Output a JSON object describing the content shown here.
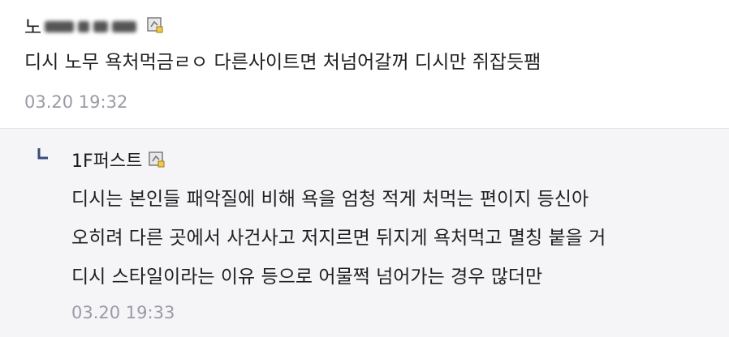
{
  "comment": {
    "nickname_visible": "노",
    "text": "디시 노무 욕처먹금ㄹㅇ 다른사이트면 처넘어갈꺼 디시만 쥐잡듯팸",
    "date": "03.20 19:32",
    "badge_icon": "fixed-nick-icon"
  },
  "reply": {
    "nickname": "1F퍼스트",
    "badge_icon": "fixed-nick-icon",
    "arrow_icon": "reply-arrow-icon",
    "lines": [
      "디시는 본인들 패악질에 비해 욕을 엄청 적게 처먹는 편이지 등신아",
      "오히려 다른 곳에서 사건사고 저지르면 뒤지게 욕처먹고 멸칭 붙을 거",
      "디시 스타일이라는 이유 등으로 어물쩍 넘어가는 경우 많더만"
    ],
    "date": "03.20 19:33"
  },
  "colors": {
    "reply_background": "#f5f5f8",
    "date_text": "#9a9aa6",
    "arrow": "#3b4a7a",
    "divider": "#e4e4ea"
  }
}
